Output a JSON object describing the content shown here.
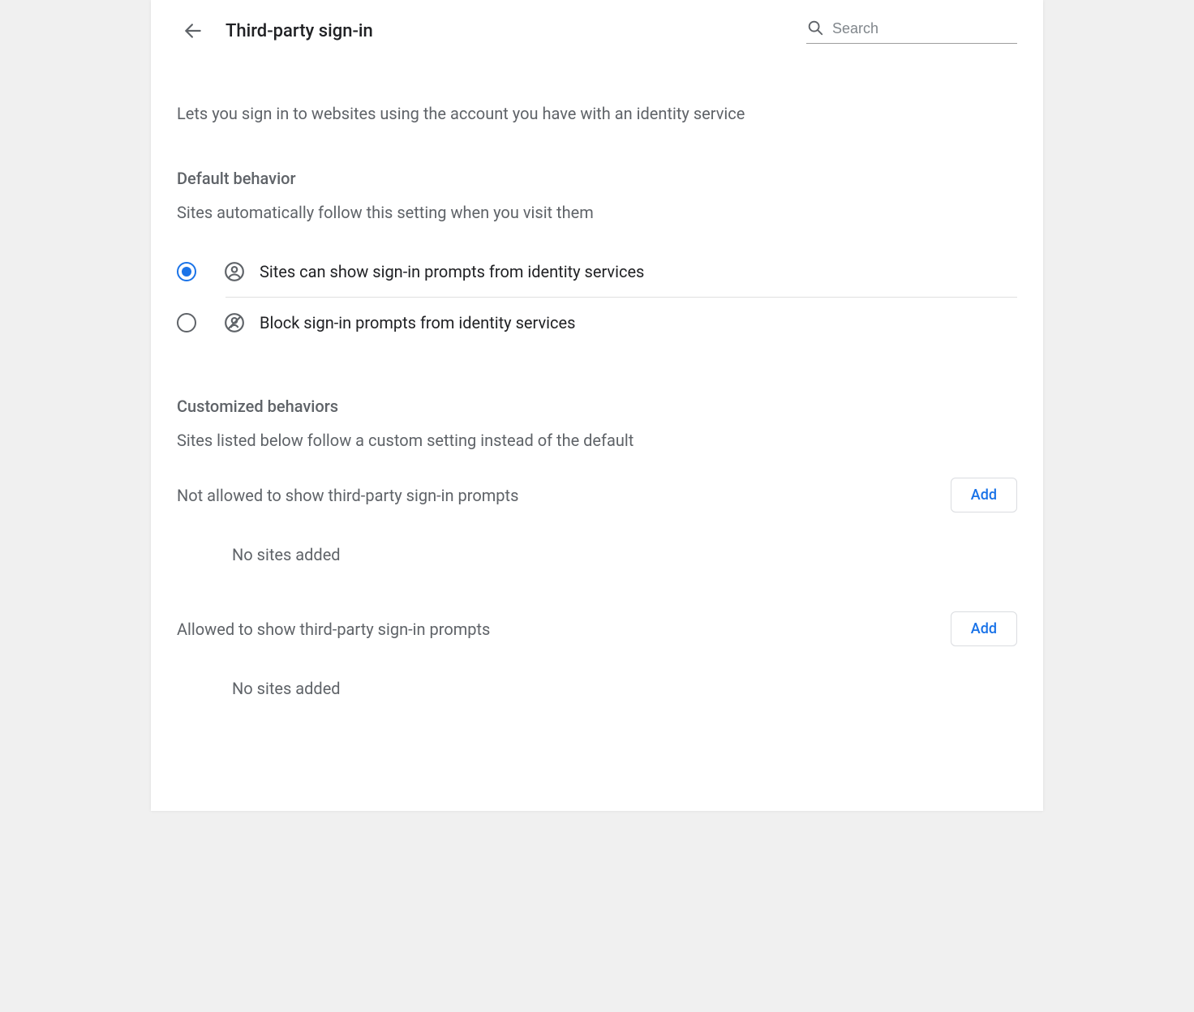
{
  "header": {
    "title": "Third-party sign-in",
    "search_placeholder": "Search"
  },
  "intro": "Lets you sign in to websites using the account you have with an identity service",
  "default_behavior": {
    "title": "Default behavior",
    "description": "Sites automatically follow this setting when you visit them",
    "options": [
      {
        "label": "Sites can show sign-in prompts from identity services",
        "selected": true
      },
      {
        "label": "Block sign-in prompts from identity services",
        "selected": false
      }
    ]
  },
  "customized_behaviors": {
    "title": "Customized behaviors",
    "description": "Sites listed below follow a custom setting instead of the default",
    "not_allowed": {
      "label": "Not allowed to show third-party sign-in prompts",
      "add_label": "Add",
      "empty": "No sites added"
    },
    "allowed": {
      "label": "Allowed to show third-party sign-in prompts",
      "add_label": "Add",
      "empty": "No sites added"
    }
  }
}
